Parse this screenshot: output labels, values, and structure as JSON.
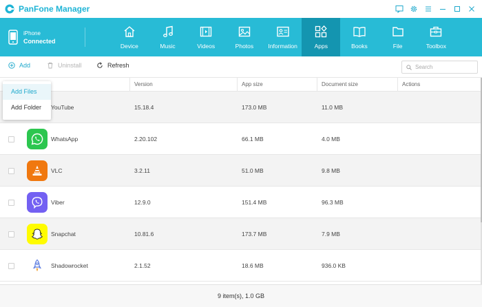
{
  "app": {
    "title": "PanFone Manager",
    "accent": "#28bbd6"
  },
  "window_controls": [
    "chat-icon",
    "gear-icon",
    "menu-icon",
    "minimize-icon",
    "maximize-icon",
    "close-icon"
  ],
  "device": {
    "name": "iPhone",
    "status": "Connected"
  },
  "nav": {
    "active": "Apps",
    "tabs": [
      {
        "label": "Device",
        "icon": "home-icon"
      },
      {
        "label": "Music",
        "icon": "music-icon"
      },
      {
        "label": "Videos",
        "icon": "film-icon"
      },
      {
        "label": "Photos",
        "icon": "image-icon"
      },
      {
        "label": "Information",
        "icon": "contact-card-icon"
      },
      {
        "label": "Apps",
        "icon": "apps-icon"
      },
      {
        "label": "Books",
        "icon": "book-icon"
      },
      {
        "label": "File",
        "icon": "folder-icon"
      },
      {
        "label": "Toolbox",
        "icon": "toolbox-icon"
      }
    ]
  },
  "toolbar": {
    "add_label": "Add",
    "uninstall_label": "Uninstall",
    "refresh_label": "Refresh",
    "search_placeholder": "Search"
  },
  "add_menu": {
    "items": [
      "Add Files",
      "Add Folder"
    ]
  },
  "table": {
    "columns": [
      "Version",
      "App size",
      "Document size",
      "Actions"
    ],
    "rows": [
      {
        "name": "YouTube",
        "version": "15.18.4",
        "app_size": "173.0 MB",
        "doc_size": "11.0 MB",
        "icon": "youtube-icon"
      },
      {
        "name": "WhatsApp",
        "version": "2.20.102",
        "app_size": "66.1 MB",
        "doc_size": "4.0 MB",
        "icon": "whatsapp-icon"
      },
      {
        "name": "VLC",
        "version": "3.2.11",
        "app_size": "51.0 MB",
        "doc_size": "9.8 MB",
        "icon": "vlc-cone-icon"
      },
      {
        "name": "Viber",
        "version": "12.9.0",
        "app_size": "151.4 MB",
        "doc_size": "96.3 MB",
        "icon": "viber-icon"
      },
      {
        "name": "Snapchat",
        "version": "10.81.6",
        "app_size": "173.7 MB",
        "doc_size": "7.9 MB",
        "icon": "snapchat-ghost-icon"
      },
      {
        "name": "Shadowrocket",
        "version": "2.1.52",
        "app_size": "18.6 MB",
        "doc_size": "936.0 KB",
        "icon": "rocket-icon"
      }
    ]
  },
  "footer": {
    "summary": "9 item(s), 1.0 GB"
  }
}
